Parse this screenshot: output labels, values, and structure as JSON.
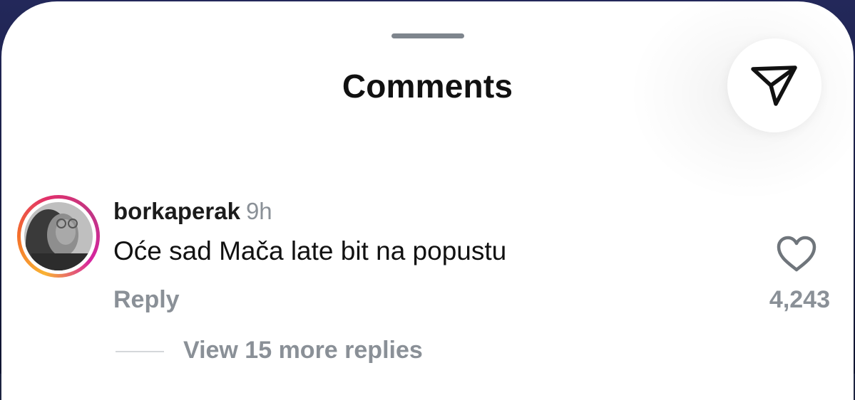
{
  "header": {
    "title": "Comments"
  },
  "share": {
    "icon": "paper-plane-icon"
  },
  "comment": {
    "username": "borkaperak",
    "time": "9h",
    "text": "Oće sad Mača late bit na popustu",
    "reply_label": "Reply",
    "like_icon": "heart-outline-icon",
    "like_count": "4,243",
    "view_replies_label": "View 15 more replies"
  },
  "colors": {
    "sheet_background": "#ffffff",
    "text_primary": "#111111",
    "text_secondary": "#8a9097",
    "story_ring_start": "#f9b233",
    "story_ring_end": "#c13584"
  }
}
